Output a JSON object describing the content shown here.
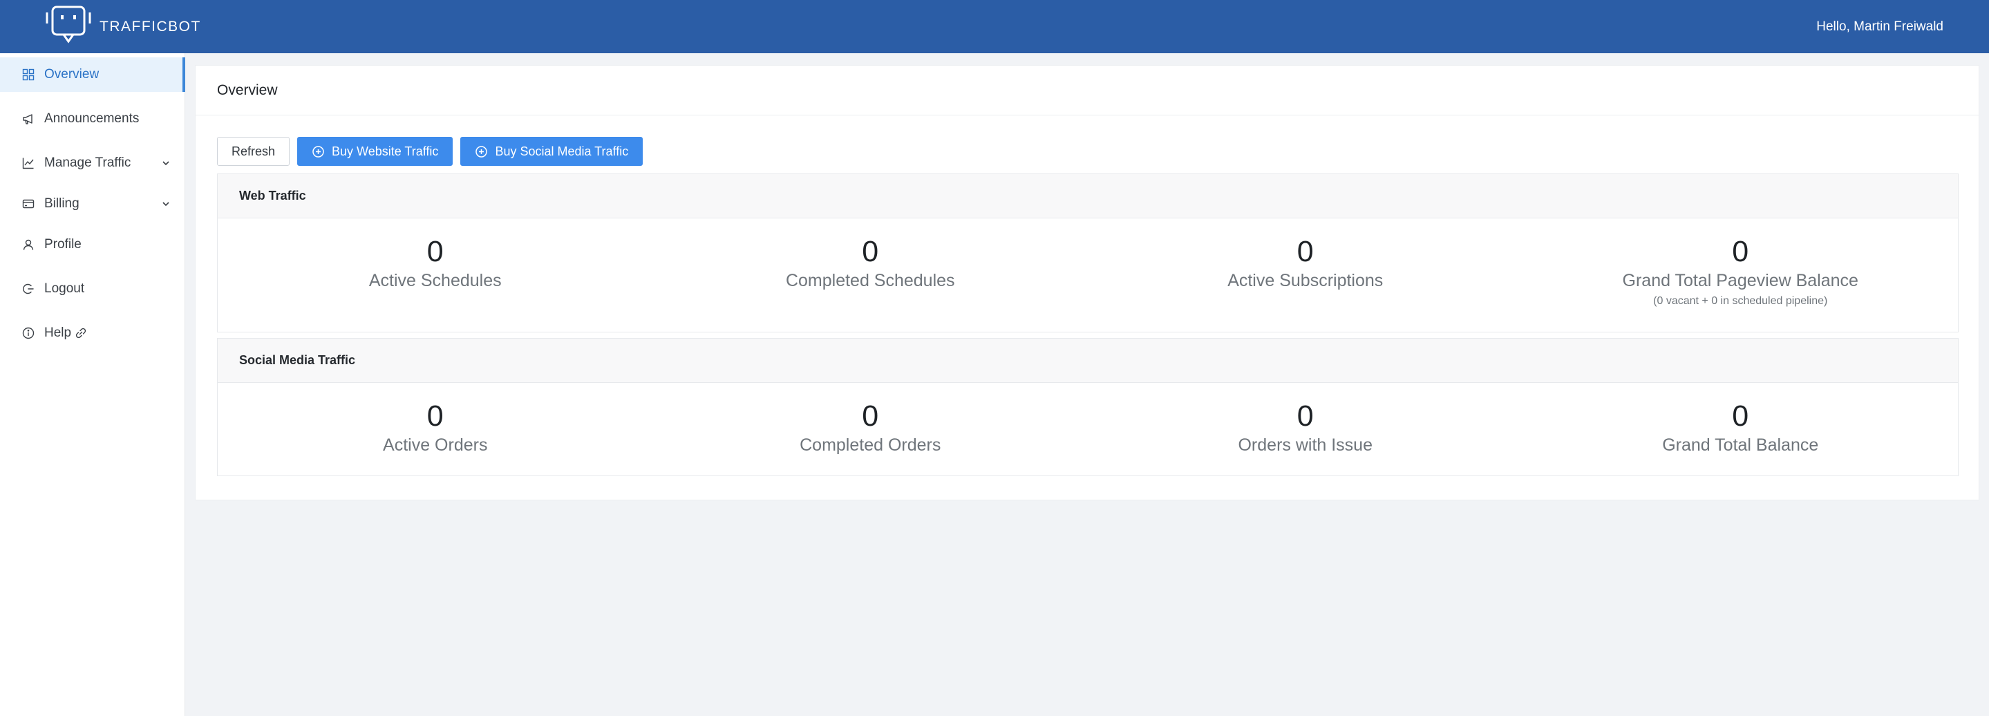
{
  "header": {
    "brand": "TRAFFICBOT",
    "greeting": "Hello, Martin Freiwald"
  },
  "sidebar": {
    "items": [
      {
        "label": "Overview",
        "icon": "grid-icon",
        "active": true
      },
      {
        "label": "Announcements",
        "icon": "megaphone-icon"
      },
      {
        "label": "Manage Traffic",
        "icon": "chart-line-icon",
        "expandable": true
      },
      {
        "label": "Billing",
        "icon": "credit-card-icon",
        "expandable": true
      },
      {
        "label": "Profile",
        "icon": "user-icon"
      },
      {
        "label": "Logout",
        "icon": "logout-icon"
      },
      {
        "label": "Help",
        "icon": "info-icon",
        "link_icon": "external-link-icon"
      }
    ]
  },
  "main": {
    "title": "Overview",
    "toolbar": {
      "refresh_label": "Refresh",
      "buy_web_label": "Buy Website Traffic",
      "buy_social_label": "Buy Social Media Traffic"
    },
    "web_traffic": {
      "title": "Web Traffic",
      "stats": [
        {
          "value": "0",
          "label": "Active Schedules"
        },
        {
          "value": "0",
          "label": "Completed Schedules"
        },
        {
          "value": "0",
          "label": "Active Subscriptions"
        },
        {
          "value": "0",
          "label": "Grand Total Pageview Balance",
          "sub": "(0 vacant + 0 in scheduled pipeline)"
        }
      ]
    },
    "social_traffic": {
      "title": "Social Media Traffic",
      "stats": [
        {
          "value": "0",
          "label": "Active Orders"
        },
        {
          "value": "0",
          "label": "Completed Orders"
        },
        {
          "value": "0",
          "label": "Orders with Issue"
        },
        {
          "value": "0",
          "label": "Grand Total Balance"
        }
      ]
    }
  },
  "colors": {
    "topbar": "#2b5da6",
    "primary_button": "#3d8bec",
    "active_nav_bg": "#e7f2fc",
    "active_nav_text": "#2a72c6"
  }
}
